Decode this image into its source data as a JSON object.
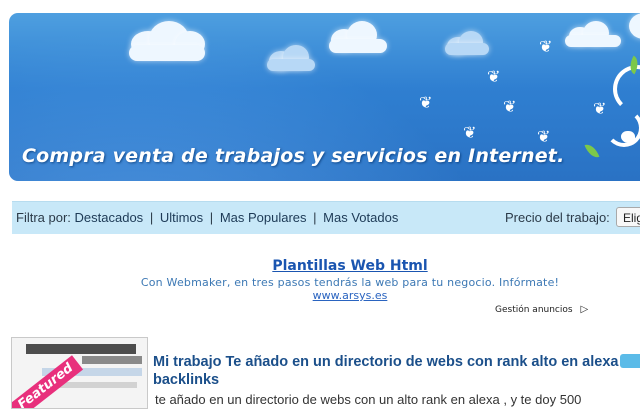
{
  "banner": {
    "title": "Compra venta de trabajos y servicios en Internet."
  },
  "filter": {
    "prefix": "Filtra por:",
    "options": [
      "Destacados",
      "Ultimos",
      "Mas Populares",
      "Mas Votados"
    ],
    "separator": "|",
    "price_label": "Precio del trabajo:",
    "price_select_value": "Elig"
  },
  "ad": {
    "title": "Plantillas Web Html",
    "text": "Con Webmaker, en tres pasos tendrás la web para tu negocio. Infórmate!",
    "url": "www.arsys.es",
    "manage_label": "Gestión anuncios"
  },
  "listing": {
    "badge": "Featured",
    "title": "Mi trabajo Te añado en un directorio de webs con rank alto en alexa + backlinks",
    "description": "te añado en un directorio de webs con un alto rank en alexa , y te doy 500"
  },
  "colors": {
    "banner_blue": "#2f7fd1",
    "filter_bg": "#c8e8f8",
    "ad_link": "#1a55b0",
    "badge_pink": "#e8307c",
    "listing_title": "#1b4f8a"
  }
}
